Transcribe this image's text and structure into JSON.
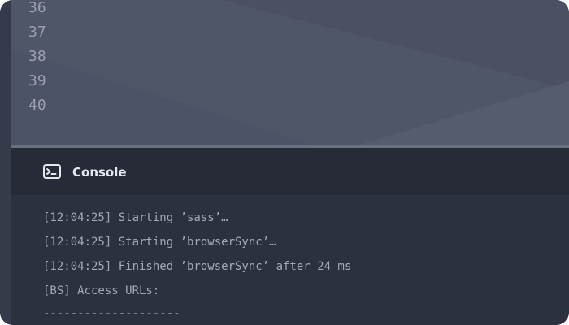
{
  "editor": {
    "line_numbers": [
      "36",
      "37",
      "38",
      "39",
      "40"
    ]
  },
  "console": {
    "title": "Console",
    "icon": "terminal-icon",
    "lines": [
      "[12:04:25] Starting ’sass’…",
      "[12:04:25] Starting ’browserSync’…",
      "[12:04:25] Finished ’browserSync’ after 24 ms",
      "[BS] Access URLs:",
      "--------------------"
    ]
  },
  "colors": {
    "editor_bg": "#4b5163",
    "console_header_bg": "#262b37",
    "console_body_bg": "#2c3140",
    "console_text": "#a3a9b7"
  }
}
